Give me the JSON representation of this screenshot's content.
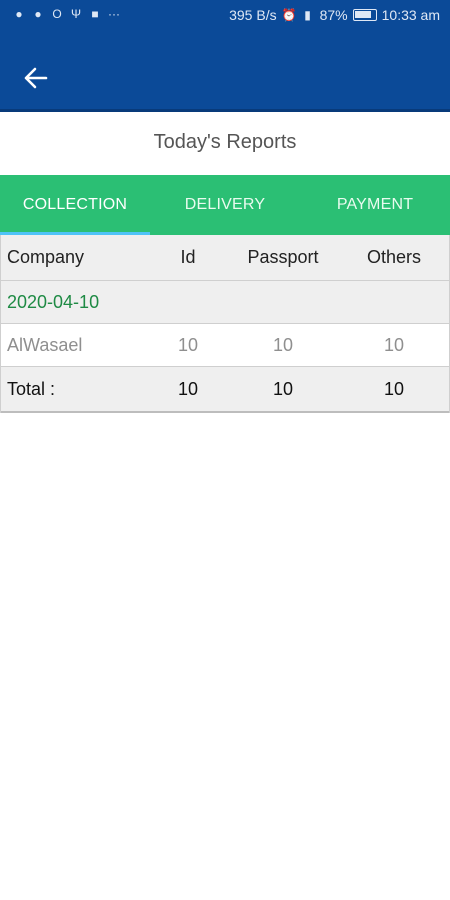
{
  "statusbar": {
    "network_speed": "395 B/s",
    "battery": "87%",
    "time": "10:33 am"
  },
  "header": {
    "title": "Today's Reports"
  },
  "tabs": [
    {
      "label": "COLLECTION"
    },
    {
      "label": "DELIVERY"
    },
    {
      "label": "PAYMENT"
    }
  ],
  "table": {
    "columns": [
      "Company",
      "Id",
      "Passport",
      "Others"
    ],
    "date": "2020-04-10",
    "rows": [
      {
        "company": "AlWasael",
        "id": "10",
        "passport": "10",
        "others": "10"
      }
    ],
    "total": {
      "label": "Total :",
      "id": "10",
      "passport": "10",
      "others": "10"
    }
  },
  "colors": {
    "appbar": "#0b4a98",
    "tabs": "#2bbf74",
    "date_text": "#1e8a44"
  }
}
